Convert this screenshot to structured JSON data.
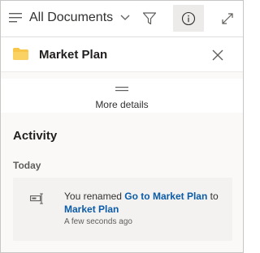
{
  "toolbar": {
    "view_label": "All Documents",
    "icons": [
      "menu-lines-icon",
      "chevron-down-icon",
      "filter-icon",
      "info-icon",
      "expand-icon"
    ]
  },
  "header": {
    "title": "Market Plan",
    "folder_color": "#f8c74a"
  },
  "details": {
    "label": "More details"
  },
  "activity": {
    "heading": "Activity",
    "group_label": "Today",
    "item": {
      "prefix": "You renamed",
      "old_name": "Go to Market Plan",
      "joiner": "to",
      "new_name": "Market Plan",
      "time": "A few seconds ago"
    }
  },
  "colors": {
    "link": "#0c5ba6",
    "active_button_bg": "#edebe9",
    "panel_bg": "#faf9f8"
  }
}
